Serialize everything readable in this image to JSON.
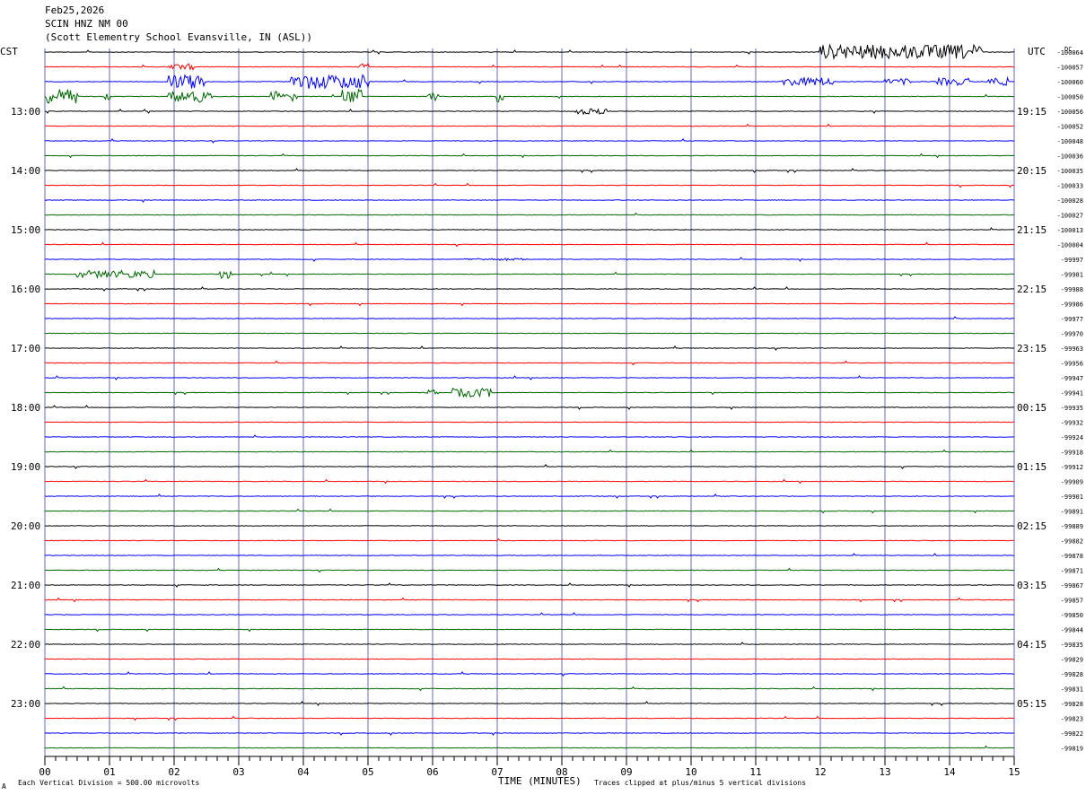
{
  "header": {
    "date": "Feb25,2026",
    "station": "SCIN HNZ NM 00",
    "location": "(Scott Elementry School Evansville, IN (ASL))"
  },
  "left_tz": "CST",
  "right_tz": "UTC",
  "dc_label": "DC",
  "footer": {
    "scale": "Each Vertical Division =  500.00 microvolts",
    "clip": "Traces clipped at plus/minus 5 vertical divisions",
    "mark": "A"
  },
  "chart_data": {
    "type": "line",
    "title": "",
    "xlabel": "TIME (MINUTES)",
    "x_ticks": [
      "00",
      "01",
      "02",
      "03",
      "04",
      "05",
      "06",
      "07",
      "08",
      "09",
      "10",
      "11",
      "12",
      "13",
      "14",
      "15"
    ],
    "xlim": [
      0,
      15
    ],
    "row_minutes": 15,
    "rows_count": 48,
    "trace_colors": [
      "#000000",
      "#ff0000",
      "#0000ff",
      "#006600"
    ],
    "grid_minute_color": "#6a6ab8",
    "left_hour_labels": [
      "13:00",
      "14:00",
      "15:00",
      "16:00",
      "17:00",
      "18:00",
      "19:00",
      "20:00",
      "21:00",
      "22:00",
      "23:00"
    ],
    "right_hour_labels": [
      "19:15",
      "20:15",
      "21:15",
      "22:15",
      "23:15",
      "00:15",
      "01:15",
      "02:15",
      "03:15",
      "04:15",
      "05:15"
    ],
    "dc_offsets": [
      "-100064",
      "-100057",
      "-100060",
      "-100050",
      "-100056",
      "-100052",
      "-100048",
      "-100036",
      "-100035",
      "-100033",
      "-100028",
      "-100027",
      "-100013",
      "-100004",
      "-99997",
      "-99981",
      "-99988",
      "-99986",
      "-99977",
      "-99970",
      "-99963",
      "-99956",
      "-99947",
      "-99941",
      "-99935",
      "-99932",
      "-99924",
      "-99918",
      "-99912",
      "-99909",
      "-99901",
      "-99891",
      "-99889",
      "-99882",
      "-99878",
      "-99871",
      "-99867",
      "-99857",
      "-99850",
      "-99844",
      "-99835",
      "-99829",
      "-99828",
      "-99831",
      "-99828",
      "-99823",
      "-99822",
      "-99819"
    ],
    "events": [
      {
        "row": 0,
        "from_min": 12.0,
        "to_min": 14.5,
        "amp": 1.0
      },
      {
        "row": 1,
        "from_min": 1.9,
        "to_min": 2.3,
        "amp": 0.4
      },
      {
        "row": 1,
        "from_min": 4.8,
        "to_min": 5.0,
        "amp": 0.5
      },
      {
        "row": 2,
        "from_min": 1.9,
        "to_min": 2.5,
        "amp": 1.0
      },
      {
        "row": 2,
        "from_min": 3.8,
        "to_min": 5.0,
        "amp": 1.0
      },
      {
        "row": 2,
        "from_min": 11.4,
        "to_min": 12.2,
        "amp": 0.6
      },
      {
        "row": 2,
        "from_min": 13.0,
        "to_min": 13.4,
        "amp": 0.4
      },
      {
        "row": 2,
        "from_min": 13.8,
        "to_min": 14.3,
        "amp": 0.5
      },
      {
        "row": 2,
        "from_min": 14.6,
        "to_min": 14.9,
        "amp": 0.6
      },
      {
        "row": 3,
        "from_min": 0.0,
        "to_min": 0.5,
        "amp": 1.0
      },
      {
        "row": 3,
        "from_min": 0.9,
        "to_min": 1.0,
        "amp": 0.5
      },
      {
        "row": 3,
        "from_min": 1.9,
        "to_min": 2.6,
        "amp": 0.8
      },
      {
        "row": 3,
        "from_min": 3.5,
        "to_min": 3.9,
        "amp": 0.7
      },
      {
        "row": 3,
        "from_min": 4.6,
        "to_min": 4.9,
        "amp": 1.0
      },
      {
        "row": 3,
        "from_min": 5.9,
        "to_min": 6.1,
        "amp": 0.6
      },
      {
        "row": 3,
        "from_min": 7.0,
        "to_min": 7.1,
        "amp": 0.8
      },
      {
        "row": 4,
        "from_min": 8.2,
        "to_min": 8.7,
        "amp": 0.4
      },
      {
        "row": 14,
        "from_min": 6.5,
        "to_min": 7.5,
        "amp": 0.15
      },
      {
        "row": 15,
        "from_min": 0.5,
        "to_min": 1.2,
        "amp": 0.5
      },
      {
        "row": 15,
        "from_min": 1.3,
        "to_min": 1.7,
        "amp": 0.5
      },
      {
        "row": 15,
        "from_min": 2.7,
        "to_min": 2.9,
        "amp": 0.6
      },
      {
        "row": 23,
        "from_min": 5.9,
        "to_min": 6.1,
        "amp": 0.4
      },
      {
        "row": 23,
        "from_min": 6.3,
        "to_min": 6.9,
        "amp": 0.6
      }
    ]
  }
}
